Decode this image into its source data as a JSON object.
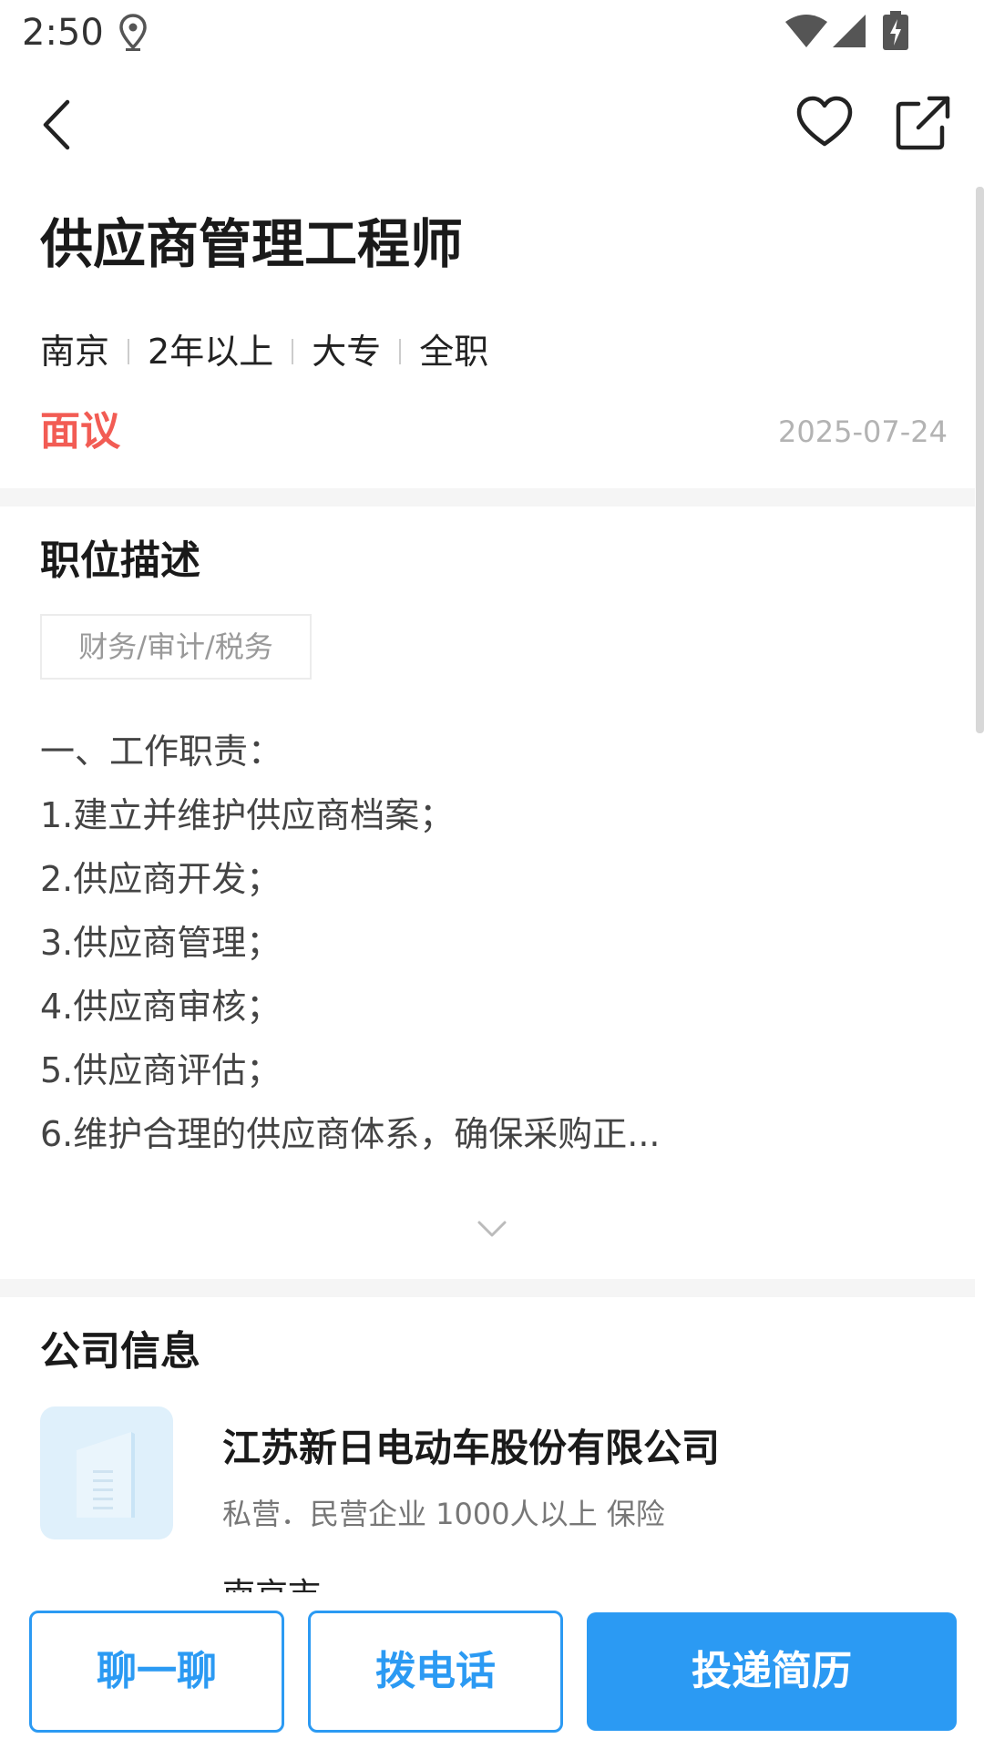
{
  "status_bar": {
    "time": "2:50",
    "icons": [
      "location-icon",
      "wifi-icon",
      "signal-icon",
      "battery-charging-icon"
    ]
  },
  "top_bar": {
    "icons": [
      "back-arrow-icon",
      "heart-icon",
      "share-icon"
    ]
  },
  "job": {
    "title": "供应商管理工程师",
    "tags": [
      "南京",
      "2年以上",
      "大专",
      "全职"
    ],
    "salary": "面议",
    "date": "2025-07-24"
  },
  "description": {
    "section_title": "职位描述",
    "category": "财务/审计/税务",
    "lines": [
      "一、工作职责：",
      "1.建立并维护供应商档案；",
      "2.供应商开发；",
      "3.供应商管理；",
      "4.供应商审核；",
      "5.供应商评估；",
      "6.维护合理的供应商体系，确保采购正..."
    ]
  },
  "company": {
    "section_title": "公司信息",
    "name": "江苏新日电动车股份有限公司",
    "meta": "私营．民营企业 1000人以上 保险",
    "city": "南京市"
  },
  "actions": {
    "chat": "聊一聊",
    "call": "拨电话",
    "apply": "投递简历"
  },
  "colors": {
    "accent": "#2b9af3",
    "salary": "#f25c54",
    "divider": "#f5f5f5"
  }
}
